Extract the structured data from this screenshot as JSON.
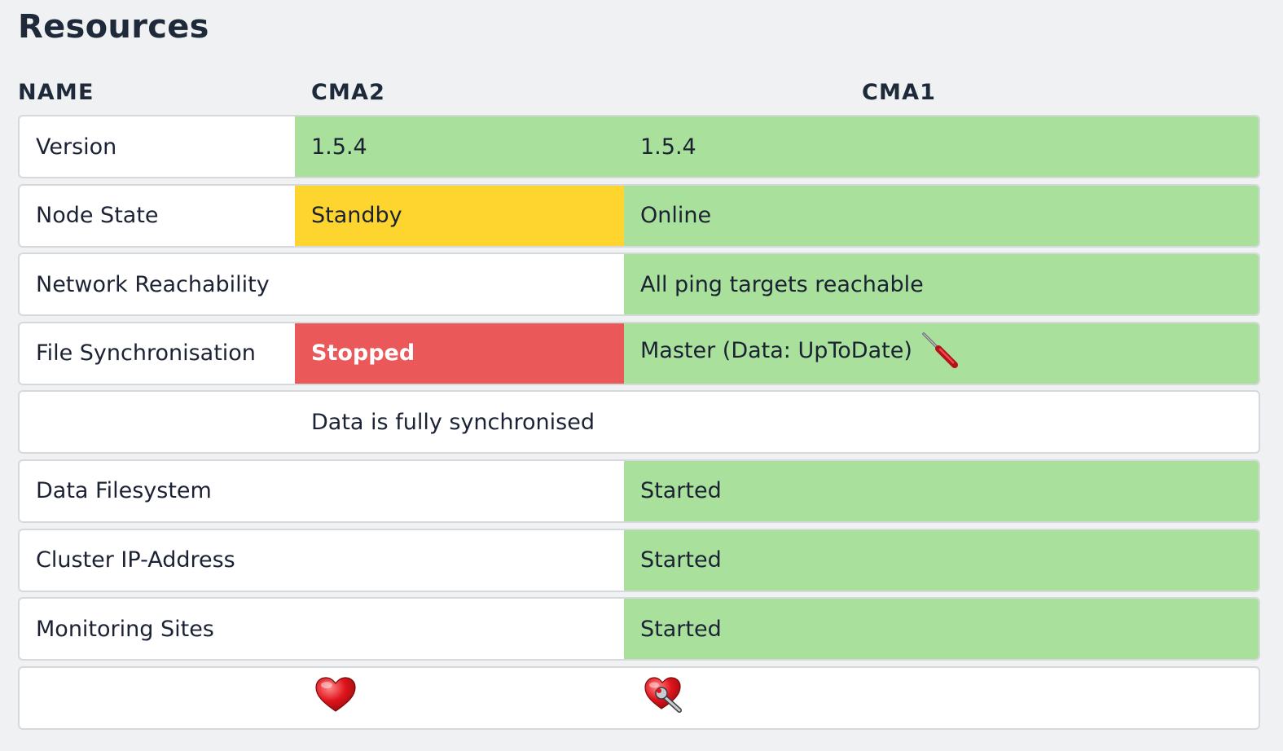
{
  "title": "Resources",
  "columns": {
    "name": "NAME",
    "cma2": "CMA2",
    "cma1": "CMA1"
  },
  "rows": {
    "version": {
      "name": "Version",
      "cma2": "1.5.4",
      "cma1": "1.5.4"
    },
    "node_state": {
      "name": "Node State",
      "cma2": "Standby",
      "cma1": "Online"
    },
    "network": {
      "name": "Network Reachability",
      "cma1": "All ping targets reachable"
    },
    "file_sync": {
      "name": "File Synchronisation",
      "cma2": "Stopped",
      "cma1": "Master (Data: UpToDate)"
    },
    "sync_info": {
      "text": "Data is fully synchronised"
    },
    "data_fs": {
      "name": "Data Filesystem",
      "cma1": "Started"
    },
    "cluster_ip": {
      "name": "Cluster IP-Address",
      "cma1": "Started"
    },
    "monitoring": {
      "name": "Monitoring Sites",
      "cma1": "Started"
    }
  },
  "icons": {
    "file_sync_action": "screwdriver-icon",
    "cma2_status": "heart-icon",
    "cma1_status": "heart-wrench-icon"
  },
  "colors": {
    "ok": "#a8e09c",
    "warn": "#fed52e",
    "crit": "#ea5859"
  }
}
